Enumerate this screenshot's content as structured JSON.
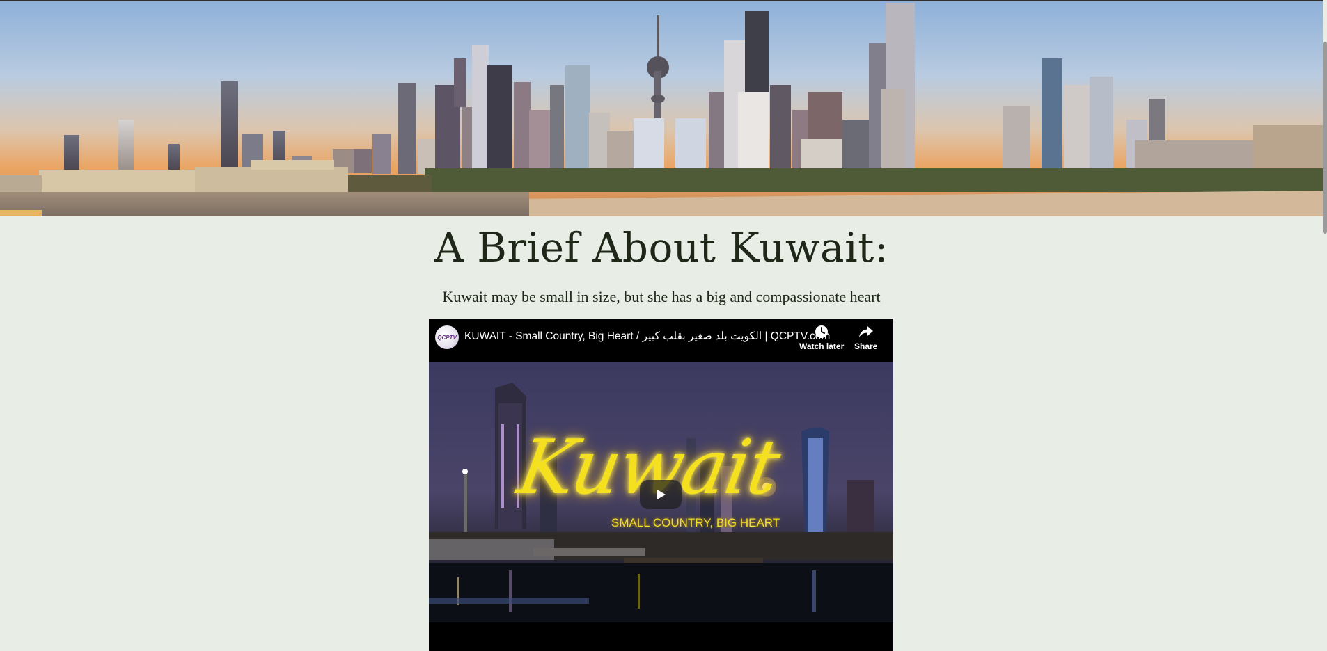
{
  "page": {
    "heading": "A Brief About Kuwait:",
    "subheading": "Kuwait may be small in size, but she has a big and compassionate heart"
  },
  "video": {
    "channel_avatar_text": "QCPTV",
    "title": "KUWAIT - Small Country, Big Heart / الكويت بلد صغير بقلب كبير | QCPTV.com",
    "watch_later_label": "Watch later",
    "share_label": "Share",
    "thumbnail_title": "Kuwait",
    "thumbnail_tagline": "SMALL COUNTRY, BIG HEART"
  },
  "colors": {
    "background": "#e8eee6",
    "heading": "#1f2818",
    "thumbnail_text": "#f4e01e"
  }
}
